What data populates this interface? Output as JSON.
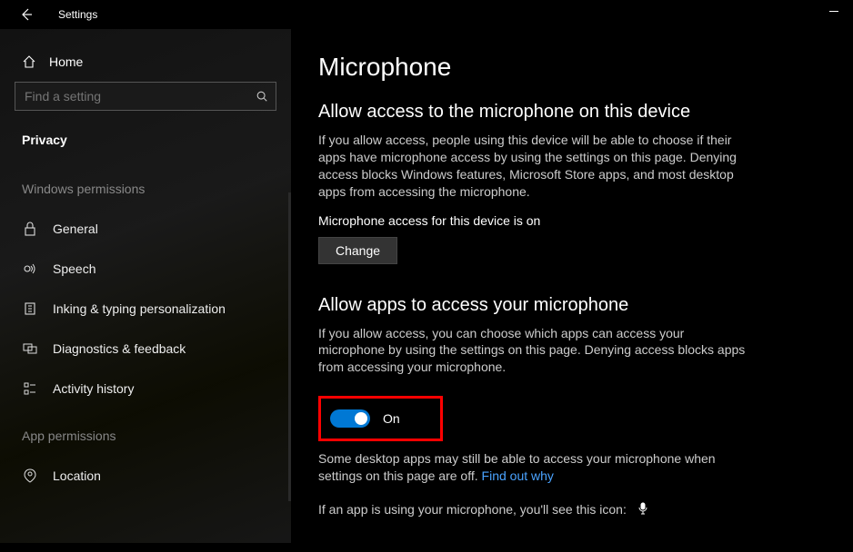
{
  "titlebar": {
    "title": "Settings"
  },
  "sidebar": {
    "home": "Home",
    "search_placeholder": "Find a setting",
    "category": "Privacy",
    "section_windows": "Windows permissions",
    "section_app": "App permissions",
    "items": [
      {
        "label": "General"
      },
      {
        "label": "Speech"
      },
      {
        "label": "Inking & typing personalization"
      },
      {
        "label": "Diagnostics & feedback"
      },
      {
        "label": "Activity history"
      }
    ],
    "app_items": [
      {
        "label": "Location"
      }
    ]
  },
  "main": {
    "title": "Microphone",
    "section1": {
      "heading": "Allow access to the microphone on this device",
      "body": "If you allow access, people using this device will be able to choose if their apps have microphone access by using the settings on this page. Denying access blocks Windows features, Microsoft Store apps, and most desktop apps from accessing the microphone.",
      "status": "Microphone access for this device is on",
      "change_btn": "Change"
    },
    "section2": {
      "heading": "Allow apps to access your microphone",
      "body": "If you allow access, you can choose which apps can access your microphone by using the settings on this page. Denying access blocks apps from accessing your microphone.",
      "toggle_label": "On",
      "note_pre": "Some desktop apps may still be able to access your microphone when settings on this page are off. ",
      "note_link": "Find out why",
      "usage_line": "If an app is using your microphone, you'll see this icon:"
    }
  }
}
